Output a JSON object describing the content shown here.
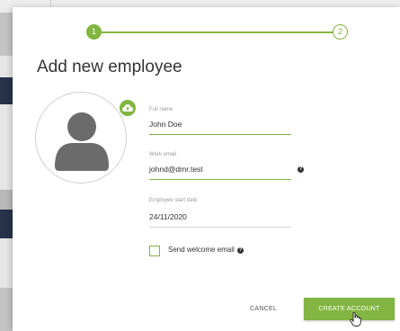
{
  "stepper": {
    "step1": "1",
    "step2": "2",
    "accent_color": "#82b541"
  },
  "modal": {
    "title": "Add new employee"
  },
  "avatar": {
    "icon": "user-silhouette-icon",
    "upload_icon": "cloud-upload-icon"
  },
  "form": {
    "full_name": {
      "label": "Full name",
      "value": "John Doe"
    },
    "work_email": {
      "label": "Work email",
      "value": "johnd@dmr.test",
      "help_icon": "help-circle-icon"
    },
    "start_date": {
      "label": "Employee start date",
      "value": "24/11/2020"
    },
    "welcome_email": {
      "label": "Send welcome email",
      "checked": false,
      "help_icon": "help-circle-icon"
    }
  },
  "actions": {
    "cancel": "CANCEL",
    "create": "CREATE ACCOUNT"
  }
}
